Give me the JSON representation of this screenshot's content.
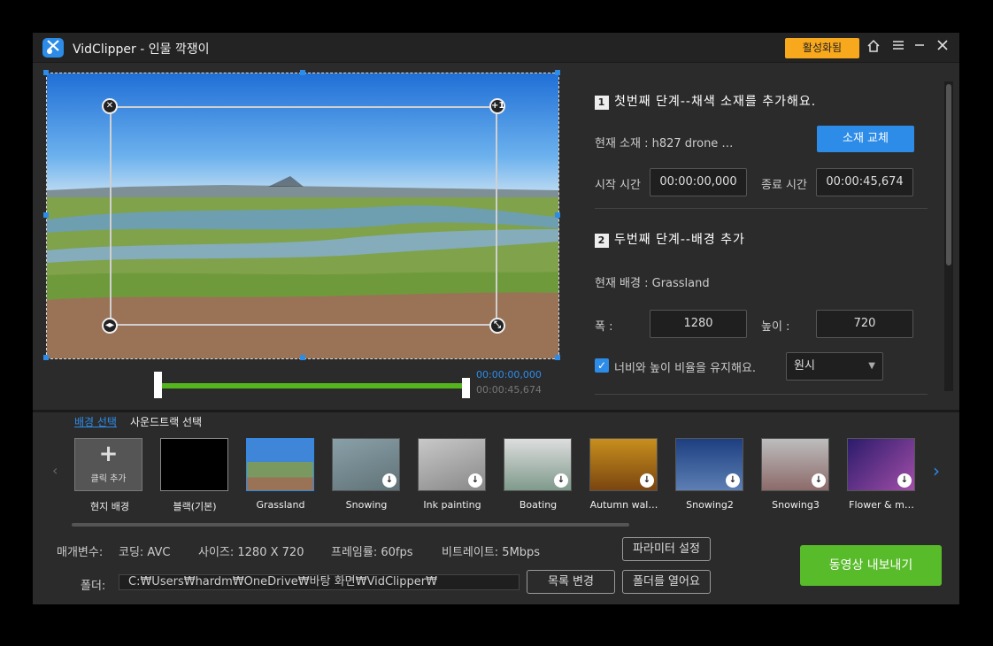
{
  "window": {
    "title": "VidClipper - 인물 깍쟁이",
    "activate_label": "활성화됨"
  },
  "player": {
    "current_time": "00:00:00,000",
    "total_time": "00:00:45,674"
  },
  "step1": {
    "num": "1",
    "title": "첫번째 단계--채색 소재를 추가해요.",
    "material_label": "현재 소재 : h827 drone …",
    "replace_label": "소재 교체",
    "start_label": "시작 시간",
    "start_value": "00:00:00,000",
    "end_label": "종료 시간",
    "end_value": "00:00:45,674"
  },
  "step2": {
    "num": "2",
    "title": "두번째 단계--배경 추가",
    "bg_label": "현재 배경 : Grassland",
    "width_label": "폭 :",
    "width_value": "1280",
    "height_label": "높이 :",
    "height_value": "720",
    "ratio_label": "너비와 높이 비율을 유지해요.",
    "ratio_select": "원시"
  },
  "bottom": {
    "tab_bg": "배경 선택",
    "tab_sound": "사운드트랙 선택",
    "add_label": "클릭 추가",
    "thumbs": [
      {
        "label": "현지 배경"
      },
      {
        "label": "블랙(기본)"
      },
      {
        "label": "Grassland"
      },
      {
        "label": "Snowing"
      },
      {
        "label": "Ink painting"
      },
      {
        "label": "Boating"
      },
      {
        "label": "Autumn wal…"
      },
      {
        "label": "Snowing2"
      },
      {
        "label": "Snowing3"
      },
      {
        "label": "Flower & m…"
      }
    ]
  },
  "footer": {
    "params_label": "매개변수:",
    "codec": "코딩: AVC",
    "size": "사이즈: 1280 X 720",
    "framerate": "프레임률: 60fps",
    "bitrate": "비트레이트: 5Mbps",
    "param_settings": "파라미터 설정",
    "folder_label": "폴더:",
    "folder_path": "C:₩Users₩hardm₩OneDrive₩바탕 화면₩VidClipper₩",
    "change_dir": "목록 변경",
    "open_folder": "폴더를 열어요",
    "export_label": "동영상 내보내기"
  },
  "colors": {
    "accent": "#2d8ce8",
    "activate": "#f8a81c",
    "export": "#58bb2a"
  }
}
